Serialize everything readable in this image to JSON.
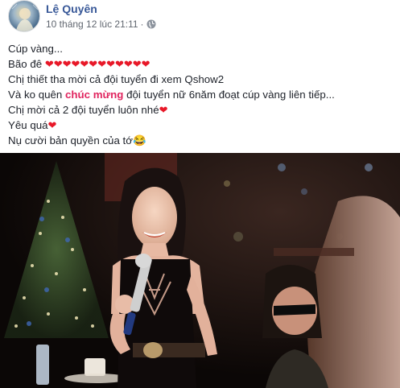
{
  "post": {
    "author": "Lệ Quyên",
    "timestamp": "10 tháng 12 lúc 21:11",
    "separator": "·",
    "privacy_icon": "globe-icon",
    "lines": {
      "l1": "Cúp vàng...",
      "l2_prefix": "Bão đê ",
      "l2_hearts": "❤❤❤❤❤❤❤❤❤❤❤❤",
      "l3": "Chị thiết tha mời cả đội tuyển đi xem Qshow2",
      "l4_a": "Và ko quên ",
      "l4_highlight": "chúc mừng",
      "l4_b": " đội tuyển nữ 6năm đoạt cúp vàng liên tiếp...",
      "l5": "Chị mời cả 2 đội tuyển luôn nhé",
      "l5_heart": "❤",
      "l6": "Yêu quá",
      "l6_heart": "❤",
      "l7": "Nụ cười bản quyền của tớ",
      "l7_emoji": "😂"
    },
    "colors": {
      "author": "#385898",
      "meta": "#616770",
      "highlight": "#e0245e",
      "heart": "#e81828"
    }
  }
}
